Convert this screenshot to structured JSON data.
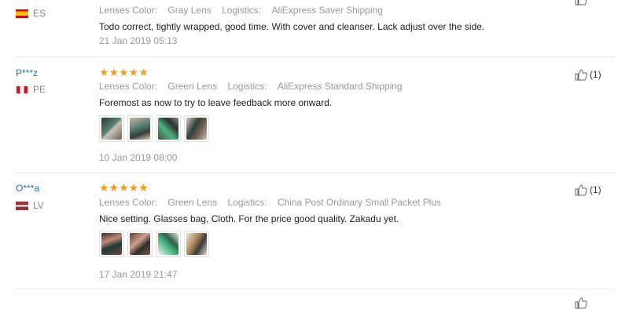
{
  "reviews": [
    {
      "user": "",
      "country_code": "ES",
      "color_label": "Lenses Color:",
      "color_value": "Gray Lens",
      "logistics_label": "Logistics:",
      "logistics_value": "AliExpress Saver Shipping",
      "text": "Todo correct, tightly wrapped, good time. With cover and cleanser. Lack adjust over the side.",
      "date": "21 Jan 2019 05:13",
      "helpful_count": ""
    },
    {
      "user": "P***z",
      "country_code": "PE",
      "rating": "★★★★★",
      "color_label": "Lenses Color:",
      "color_value": "Green Lens",
      "logistics_label": "Logistics:",
      "logistics_value": "AliExpress Standard Shipping",
      "text": "Foremost as now to try to leave feedback more onward.",
      "date": "10 Jan 2019 08:00",
      "helpful_count": "(1)"
    },
    {
      "user": "O***a",
      "country_code": "LV",
      "rating": "★★★★★",
      "color_label": "Lenses Color:",
      "color_value": "Green Lens",
      "logistics_label": "Logistics:",
      "logistics_value": "China Post Ordinary Small Packet Plus",
      "text": "Nice setting. Glasses bag, Cloth. For the price good quality. Zakadu yet.",
      "date": "17 Jan 2019 21:47",
      "helpful_count": "(1)"
    }
  ],
  "icons": {
    "thumbs_up": "thumbs-up-icon"
  },
  "colors": {
    "star": "#f59b1c",
    "username": "#2b6fb6"
  }
}
